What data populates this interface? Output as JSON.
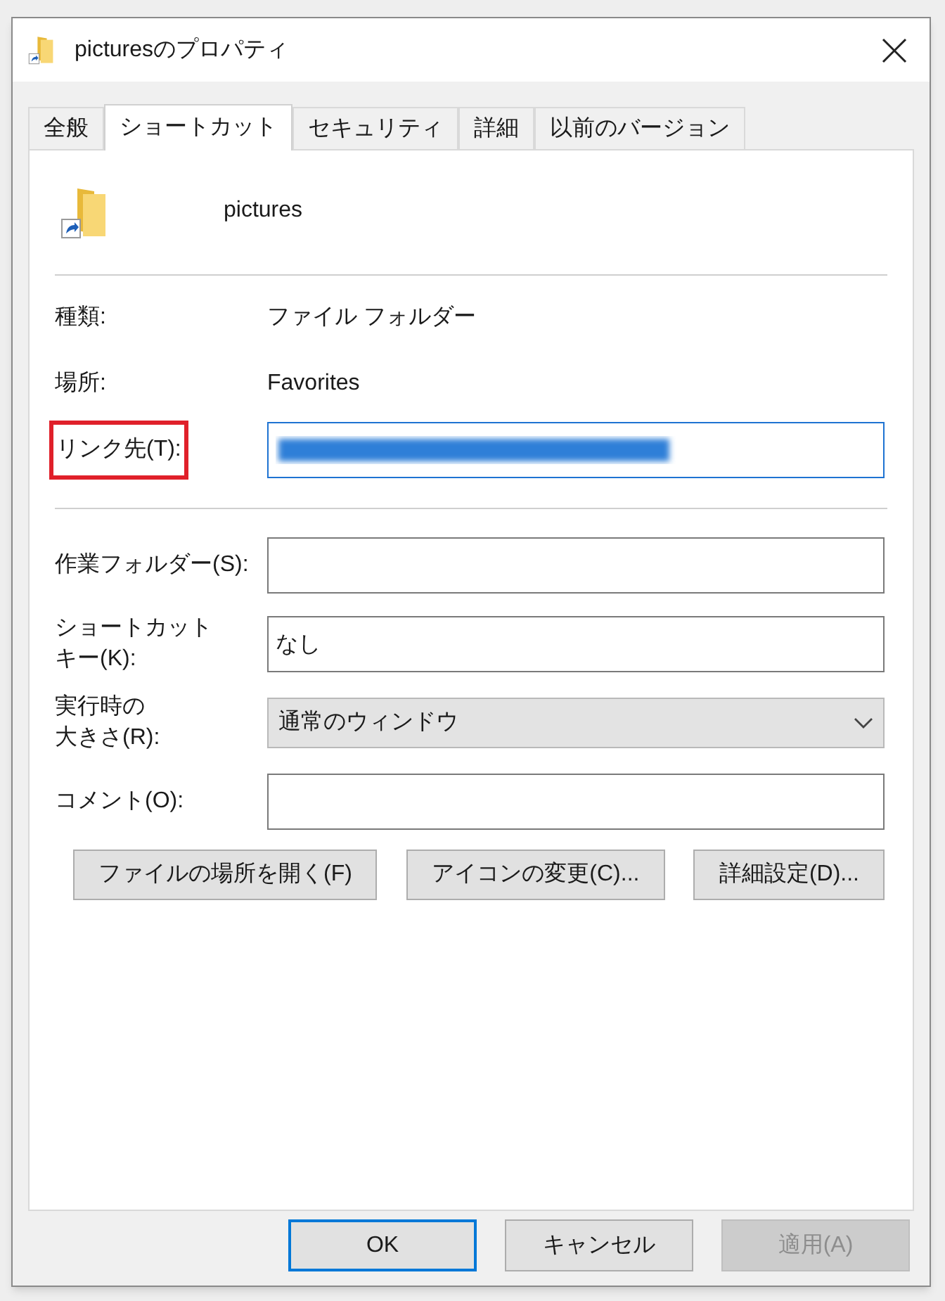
{
  "window": {
    "title": "picturesのプロパティ"
  },
  "tabs": [
    {
      "label": "全般",
      "selected": false
    },
    {
      "label": "ショートカット",
      "selected": true
    },
    {
      "label": "セキュリティ",
      "selected": false
    },
    {
      "label": "詳細",
      "selected": false
    },
    {
      "label": "以前のバージョン",
      "selected": false
    }
  ],
  "header": {
    "name": "pictures"
  },
  "info": [
    {
      "label": "種類:",
      "value": "ファイル フォルダー"
    },
    {
      "label": "場所:",
      "value": "Favorites"
    }
  ],
  "target_field": {
    "label": "リンク先(T):",
    "highlighted": true,
    "focused": true,
    "redacted": true
  },
  "fields": [
    {
      "kind": "text",
      "label_lines": [
        "作業フォルダー(S):"
      ]
    },
    {
      "kind": "text",
      "label_lines": [
        "ショートカット",
        "キー(K):"
      ],
      "value": "なし"
    },
    {
      "kind": "dropdown",
      "label_lines": [
        "実行時の",
        "大きさ(R):"
      ],
      "value": "通常のウィンドウ"
    },
    {
      "kind": "text",
      "label_lines": [
        "コメント(O):"
      ]
    }
  ],
  "action_buttons": [
    "ファイルの場所を開く(F)",
    "アイコンの変更(C)...",
    "詳細設定(D)..."
  ],
  "footer_buttons": [
    {
      "label": "OK",
      "default": true,
      "disabled": false
    },
    {
      "label": "キャンセル",
      "default": false,
      "disabled": false
    },
    {
      "label": "適用(A)",
      "default": false,
      "disabled": true
    }
  ]
}
